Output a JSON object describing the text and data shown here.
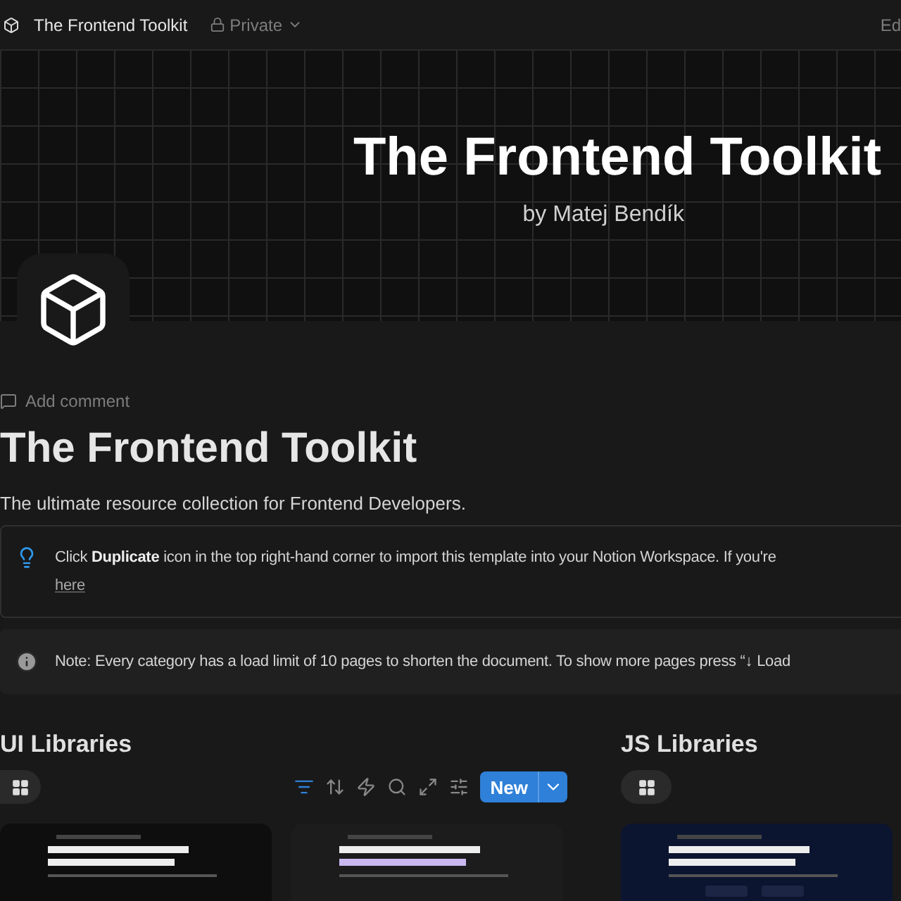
{
  "topbar": {
    "title": "The Frontend Toolkit",
    "privacy": "Private",
    "edit": "Ed"
  },
  "cover": {
    "title": "The Frontend Toolkit",
    "byline": "by Matej Bendík"
  },
  "add_comment": "Add comment",
  "title": "The Frontend Toolkit",
  "description": "The ultimate resource collection for Frontend Developers.",
  "callouts": [
    {
      "kind": "tip",
      "text": "Click **Duplicate** icon in the top right-hand corner to import this template into your Notion Workspace. If you're",
      "link": "here"
    },
    {
      "kind": "info",
      "text": "Note: Every category has a load limit of 10 pages to shorten the document. To show more pages press “↓ Load"
    }
  ],
  "sections": [
    {
      "heading": "UI Libraries",
      "toolbar": true,
      "new_label": "New"
    },
    {
      "heading": "JS Libraries",
      "toolbar": false
    }
  ]
}
